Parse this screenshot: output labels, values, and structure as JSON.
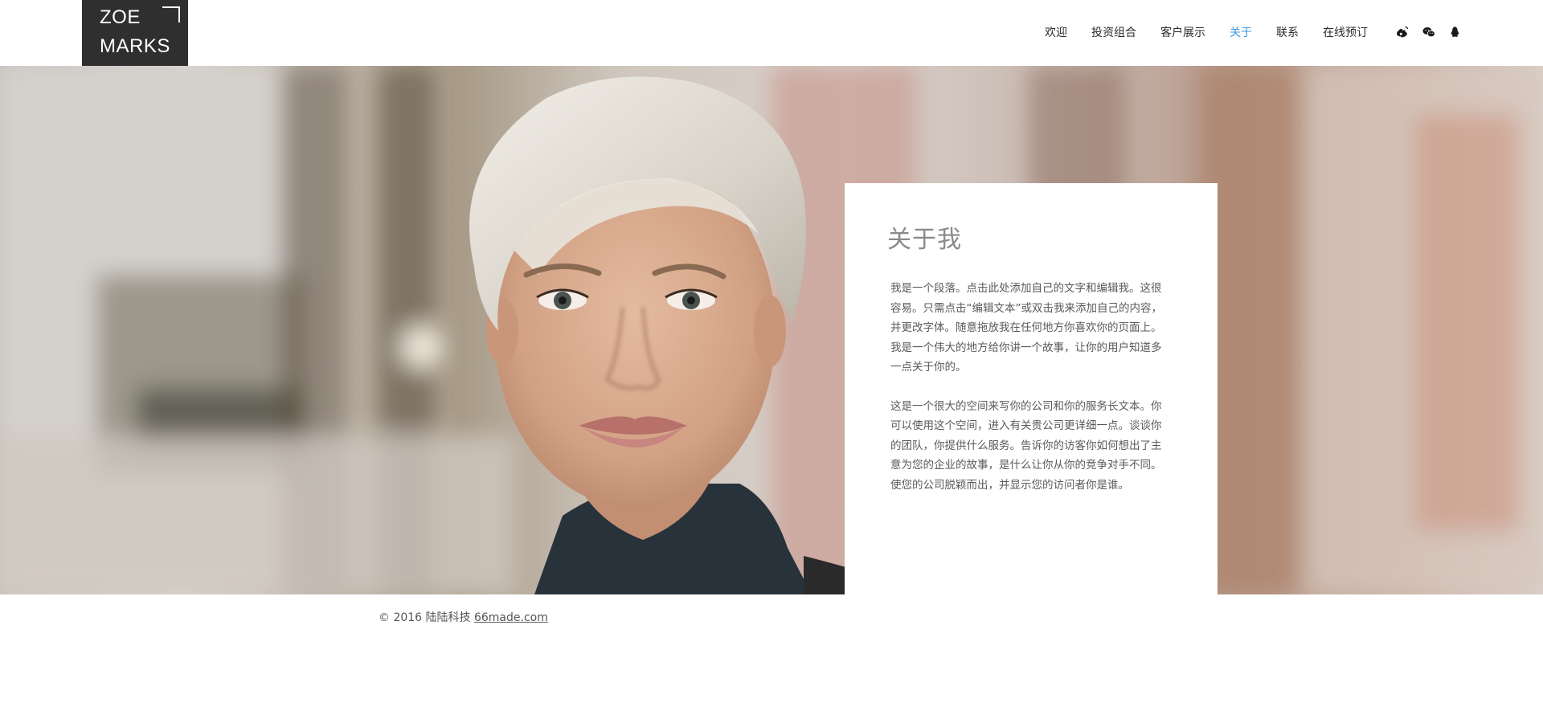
{
  "logo": {
    "line1": "ZOE",
    "line2": "MARKS"
  },
  "nav": {
    "items": [
      {
        "label": "欢迎"
      },
      {
        "label": "投资组合"
      },
      {
        "label": "客户展示"
      },
      {
        "label": "关于",
        "active": true
      },
      {
        "label": "联系"
      },
      {
        "label": "在线预订"
      }
    ]
  },
  "social": {
    "icons": [
      "weibo-icon",
      "wechat-icon",
      "qq-icon"
    ]
  },
  "about": {
    "title": "关于我",
    "paragraph1": "我是一个段落。点击此处添加自己的文字和编辑我。这很容易。只需点击“编辑文本”或双击我来添加自己的内容，并更改字体。随意拖放我在任何地方你喜欢你的页面上。我是一个伟大的地方给你讲一个故事，让你的用户知道多一点关于你的。",
    "paragraph2": "这是一个很大的空间来写你的公司和你的服务长文本。你可以使用这个空间，进入有关贵公司更详细一点。谈谈你的团队，你提供什么服务。告诉你的访客你如何想出了主意为您的企业的故事，是什么让你从你的竞争对手不同。使您的公司脱颖而出，并显示您的访问者你是谁。"
  },
  "footer": {
    "copyright": "© 2016 陆陆科技",
    "link": "66made.com"
  },
  "colors": {
    "logo_bg": "#2f2f2f",
    "nav_active": "#3b97e3",
    "text": "#2b2b2b"
  }
}
